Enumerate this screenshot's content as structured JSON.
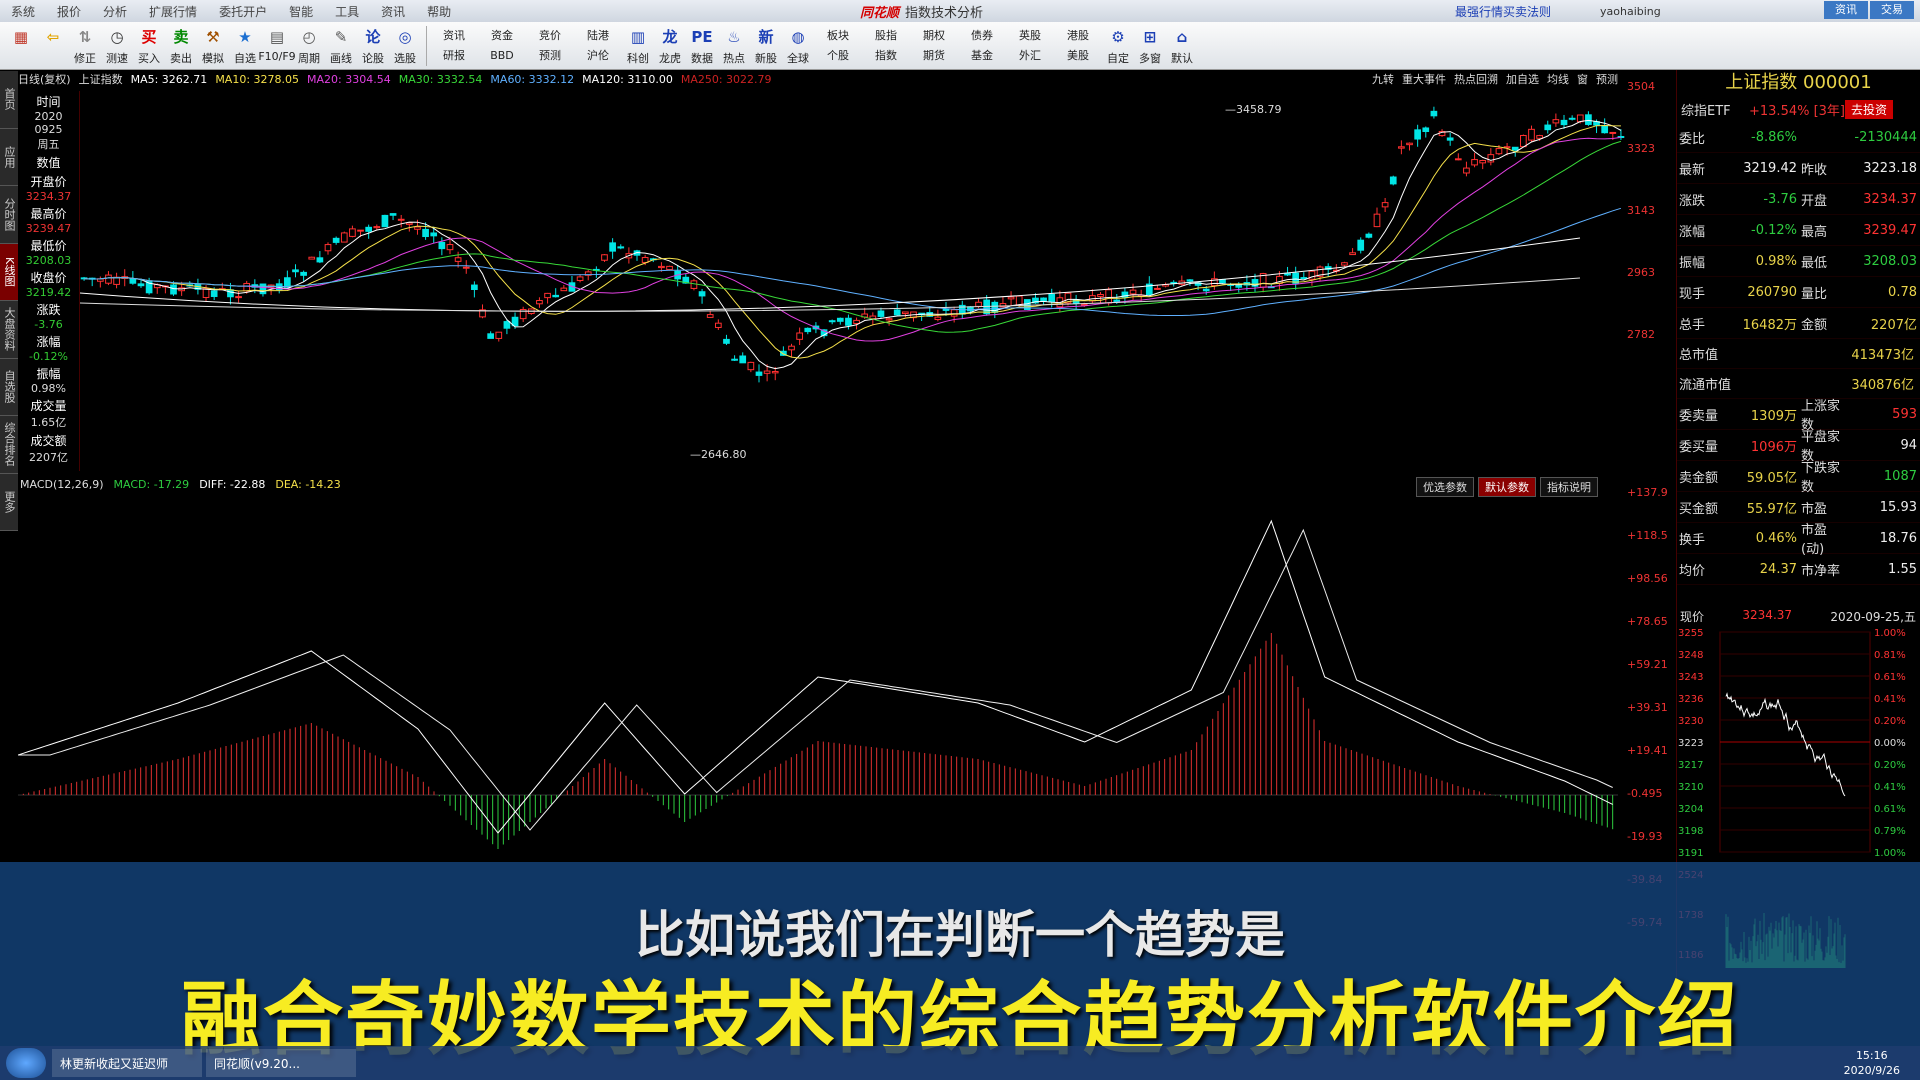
{
  "window": {
    "app_logo": "同花顺",
    "title": "指数技术分析",
    "promo": "最强行情买卖法则",
    "user": "yaohaibing",
    "menu": [
      "系统",
      "报价",
      "分析",
      "扩展行情",
      "委托开户",
      "智能",
      "工具",
      "资讯",
      "帮助"
    ],
    "win_buttons": [
      "资讯",
      "交易"
    ]
  },
  "toolbar": {
    "buttons": [
      {
        "label": "",
        "icon": "grid-icon",
        "color": "#c0392b"
      },
      {
        "label": "",
        "icon": "back-arrow-icon",
        "color": "#e2a400"
      },
      {
        "label": "修正",
        "icon": "up-down-icon",
        "color": "#888"
      },
      {
        "label": "测速",
        "icon": "clock-icon",
        "color": "#333"
      },
      {
        "label": "买入",
        "icon": "buy-icon",
        "color": "#d00"
      },
      {
        "label": "卖出",
        "icon": "sell-icon",
        "color": "#080"
      },
      {
        "label": "模拟",
        "icon": "hammer-icon",
        "color": "#a05000"
      },
      {
        "label": "自选",
        "icon": "star-icon",
        "color": "#1c6fd1"
      },
      {
        "label": "F10/F9",
        "icon": "f10-icon",
        "color": "#555"
      },
      {
        "label": "周期",
        "icon": "cycle-icon",
        "color": "#555"
      },
      {
        "label": "画线",
        "icon": "pen-icon",
        "color": "#555"
      },
      {
        "label": "论股",
        "icon": "discuss-icon",
        "color": "#1c3fb5"
      },
      {
        "label": "选股",
        "icon": "pick-icon",
        "color": "#1c3fb5"
      }
    ],
    "pairs": [
      [
        "资讯",
        "研报"
      ],
      [
        "资金",
        "BBD"
      ],
      [
        "竞价",
        "预测"
      ],
      [
        "陆港",
        "沪伦"
      ]
    ],
    "buttons2": [
      {
        "label": "科创",
        "icon": "chart-icon"
      },
      {
        "label": "龙虎",
        "icon": "dragon-icon"
      },
      {
        "label": "数据",
        "icon": "pe-icon"
      },
      {
        "label": "热点",
        "icon": "hot-icon"
      },
      {
        "label": "新股",
        "icon": "new-stock-icon"
      },
      {
        "label": "全球",
        "icon": "globe-icon"
      }
    ],
    "pairs2": [
      [
        "板块",
        "个股"
      ],
      [
        "股指",
        "指数"
      ],
      [
        "期权",
        "期货"
      ],
      [
        "债券",
        "基金"
      ],
      [
        "英股",
        "外汇"
      ],
      [
        "港股",
        "美股"
      ]
    ],
    "buttons3": [
      {
        "label": "自定",
        "icon": "custom-icon"
      },
      {
        "label": "多窗",
        "icon": "multi-window-icon"
      },
      {
        "label": "默认",
        "icon": "home-icon"
      }
    ]
  },
  "sidetabs": [
    "首页",
    "应用",
    "分时图",
    "K线图",
    "大盘资料",
    "自选股",
    "综合排名",
    "更多"
  ],
  "kline_header": {
    "period": "日线(复权)",
    "index_name": "上证指数",
    "ma": [
      {
        "label": "MA5: 3262.71",
        "color": "#ffffff"
      },
      {
        "label": "MA10: 3278.05",
        "color": "#f5e04a"
      },
      {
        "label": "MA20: 3304.54",
        "color": "#e040e0"
      },
      {
        "label": "MA30: 3332.54",
        "color": "#38d838"
      },
      {
        "label": "MA60: 3332.12",
        "color": "#5fb0ff"
      },
      {
        "label": "MA120: 3110.00",
        "color": "#ffffff"
      },
      {
        "label": "MA250: 3022.79",
        "color": "#c22"
      }
    ],
    "right_links": [
      "九转",
      "重大事件",
      "热点回溯",
      "加自选",
      "均线",
      "窗",
      "预测"
    ]
  },
  "info_column": [
    {
      "k": "时间",
      "v": "2020",
      "c": "vb"
    },
    {
      "k": "",
      "v": "0925",
      "c": "vb"
    },
    {
      "k": "",
      "v": "周五",
      "c": "vb"
    },
    {
      "k": "数值",
      "v": "",
      "c": "vb"
    },
    {
      "k": "开盘价",
      "v": "3234.37",
      "c": "v"
    },
    {
      "k": "最高价",
      "v": "3239.47",
      "c": "v"
    },
    {
      "k": "最低价",
      "v": "3208.03",
      "c": "vg"
    },
    {
      "k": "收盘价",
      "v": "3219.42",
      "c": "vg"
    },
    {
      "k": "涨跌",
      "v": "-3.76",
      "c": "vg"
    },
    {
      "k": "涨幅",
      "v": "-0.12%",
      "c": "vg"
    },
    {
      "k": "振幅",
      "v": "0.98%",
      "c": "vb"
    },
    {
      "k": "成交量",
      "v": "1.65亿",
      "c": "vb"
    },
    {
      "k": "成交额",
      "v": "2207亿",
      "c": "vb"
    }
  ],
  "k_axis": [
    "3504",
    "3323",
    "3143",
    "2963",
    "2782"
  ],
  "k_annotations": {
    "high": "3458.79",
    "low": "2646.80"
  },
  "macd": {
    "params": "MACD(12,26,9)",
    "macd_label": "MACD: -17.29",
    "diff_label": "DIFF: -22.88",
    "dea_label": "DEA: -14.23",
    "buttons": [
      "优选参数",
      "默认参数",
      "指标说明"
    ],
    "axis": [
      "+137.9",
      "+118.5",
      "+98.56",
      "+78.65",
      "+59.21",
      "+39.31",
      "+19.41",
      "-0.495",
      "-19.93",
      "-39.84",
      "-59.74"
    ]
  },
  "quote": {
    "title": "上证指数 000001",
    "etf_name": "综指ETF",
    "etf_change": "+13.54% [3年]",
    "etf_button": "去投资",
    "rows": [
      {
        "l": "委比",
        "lv": "-8.86%",
        "lc": "green",
        "r": "",
        "rv": "-2130444",
        "rc": "green"
      },
      {
        "l": "最新",
        "lv": "3219.42",
        "lc": "white",
        "r": "昨收",
        "rv": "3223.18",
        "rc": "white"
      },
      {
        "l": "涨跌",
        "lv": "-3.76",
        "lc": "green",
        "r": "开盘",
        "rv": "3234.37",
        "rc": "red"
      },
      {
        "l": "涨幅",
        "lv": "-0.12%",
        "lc": "green",
        "r": "最高",
        "rv": "3239.47",
        "rc": "red"
      },
      {
        "l": "振幅",
        "lv": "0.98%",
        "lc": "yellow",
        "r": "最低",
        "rv": "3208.03",
        "rc": "green"
      },
      {
        "l": "现手",
        "lv": "260790",
        "lc": "yellow",
        "r": "量比",
        "rv": "0.78",
        "rc": "yellow"
      },
      {
        "l": "总手",
        "lv": "16482万",
        "lc": "yellow",
        "r": "金额",
        "rv": "2207亿",
        "rc": "yellow"
      }
    ],
    "single_rows": [
      {
        "l": "总市值",
        "v": "413473亿",
        "c": "yellow"
      },
      {
        "l": "流通市值",
        "v": "340876亿",
        "c": "yellow"
      }
    ],
    "rows2": [
      {
        "l": "委卖量",
        "lv": "1309万",
        "lc": "yellow",
        "r": "上涨家数",
        "rv": "593",
        "rc": "red"
      },
      {
        "l": "委买量",
        "lv": "1096万",
        "lc": "red",
        "r": "平盘家数",
        "rv": "94",
        "rc": "white"
      },
      {
        "l": "卖金额",
        "lv": "59.05亿",
        "lc": "yellow",
        "r": "下跌家数",
        "rv": "1087",
        "rc": "green"
      },
      {
        "l": "买金额",
        "lv": "55.97亿",
        "lc": "yellow",
        "r": "市盈",
        "rv": "15.93",
        "rc": "white"
      },
      {
        "l": "换手",
        "lv": "0.46%",
        "lc": "yellow",
        "r": "市盈(动)",
        "rv": "18.76",
        "rc": "white"
      },
      {
        "l": "均价",
        "lv": "24.37",
        "lc": "yellow",
        "r": "市净率",
        "rv": "1.55",
        "rc": "white"
      }
    ],
    "mini": {
      "label": "现价",
      "price": "3234.37",
      "date": "2020-09-25,五",
      "left_axis": [
        "3255",
        "3248",
        "3243",
        "3236",
        "3230",
        "3223",
        "3217",
        "3210",
        "3204",
        "3198",
        "3191"
      ],
      "right_axis": [
        "1.00%",
        "0.81%",
        "0.61%",
        "0.41%",
        "0.20%",
        "0.00%",
        "0.20%",
        "0.41%",
        "0.61%",
        "0.79%",
        "1.00%"
      ],
      "vol_axis": [
        "2524",
        "1738",
        "1186"
      ]
    }
  },
  "subtitles": {
    "line1": "比如说我们在判断一个趋势是",
    "line2": "融合奇妙数学技术的综合趋势分析软件介绍"
  },
  "taskbar": {
    "tasks": [
      "林更新收起又延迟师",
      "同花顺(v9.20..."
    ],
    "time": "15:16",
    "date": "2020/9/26"
  }
}
